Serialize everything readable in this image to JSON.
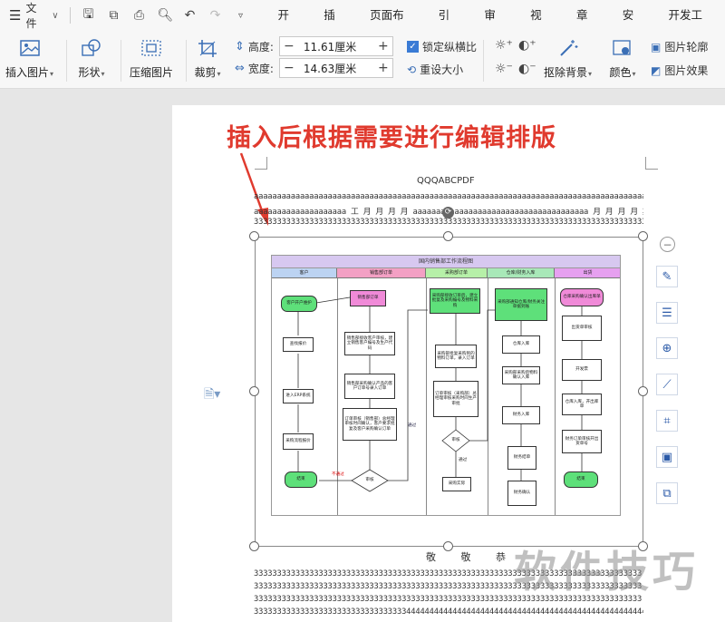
{
  "menubar": {
    "file_label": "文件",
    "tabs": [
      "开始",
      "插入",
      "页面布局",
      "引用",
      "审阅",
      "视图",
      "章节",
      "安全",
      "开发工具"
    ]
  },
  "ribbon": {
    "insert_picture": "插入图片",
    "shape": "形状",
    "compress_picture": "压缩图片",
    "crop": "裁剪",
    "height_label": "高度:",
    "height_value": "11.61厘米",
    "width_label": "宽度:",
    "width_value": "14.63厘米",
    "lock_ratio": "锁定纵横比",
    "reset_size": "重设大小",
    "remove_background": "抠除背景",
    "color": "颜色",
    "picture_outline": "图片轮廓",
    "picture_effect": "图片效果"
  },
  "annotation": "插入后根据需要进行编辑排版",
  "document": {
    "title": "QQQABCPDF",
    "line1": "aaaaaaaaaaaaaaaaaaaaaaaaaaaaaaaaaaaaaaaaaaaaaaaaaaaaaaaaaaaaaaaaaaaaaaaaaaaaaaaaaaaaaa",
    "line2": "aaaaaaaaaaaaaaaaaaaa 工 月 月 月 月   aaaaaaaaaaaaaaaaaaaaaaaaaaaaaaaaaaaaaa 月 月 月 月 期",
    "line3": "333333333333333333333333333333333333333333333333333333333333333333333333333333333333333",
    "gift_text": "敬 敬 恭",
    "bottom_lines": [
      "333333333333333333333333333333333333333333333333333333333333333333333333333333333333",
      "333333333333333333333333333333333333333333333333333333333333333333333333333333333333",
      "333333333333333333333333333333333333333333333333333333333333333333333333333333333333",
      "3333333333333333333333333333333334444444444444444444444444444444444444444444444444444",
      "4444444444444444444444444444444444444444444444444444444444444444444444444444444444444"
    ]
  },
  "flowchart": {
    "title": "国内销售部工作流程图",
    "lanes": [
      "客户",
      "销售部订单",
      "采购部订单",
      "仓库/财务入库",
      "出货"
    ],
    "nodes": {
      "n1": "客户开户维护",
      "n2": "查找报价",
      "n3": "进入ERP系统",
      "n4": "采购流程报价",
      "n5": "结束",
      "n6": "销售部订单",
      "n7": "销售部接收客户审核，建立销售客户编号及生产代码",
      "n8": "销售部采购确认产品的客户订单号录入订单",
      "n9": "订单审核（销售部）总经理审核时间确认，客户要求批复及客户采购确认订单",
      "n10": "审核",
      "n11": "采购部接收订单后，建立批复及采购编号及物料采购",
      "n12": "采购部批复采购到的物料订单，录入订单",
      "n13": "订单审核（采购部）总经理审核采购时间生产审批",
      "n14": "审核",
      "n15": "采购实际",
      "n16": "采购部通知仓库/财务关注单据到账",
      "n17": "仓库入库",
      "n18": "采购部采购后物料确认入库",
      "n19": "财务入库",
      "n20": "财务结单",
      "n21": "财务确认",
      "n22": "仓库采购确认出库单",
      "n23": "出货单审核",
      "n24": "开发票",
      "n25": "仓库入库，开出库单",
      "n26": "财务订单审核开出货单号",
      "n27": "结束"
    },
    "labels": {
      "pass": "通过",
      "fail": "不通过",
      "pass2": "通过"
    }
  },
  "watermark": "软件技巧",
  "colors": {
    "annotation_red": "#e03a2e",
    "lane1": "#bcd3f2",
    "lane2": "#f3a0c4",
    "lane3": "#b6f0a8",
    "lane4": "#a8e8b8",
    "lane5": "#e6a0f0",
    "green_node": "#5ee07a",
    "pink_node": "#f08ad8"
  }
}
